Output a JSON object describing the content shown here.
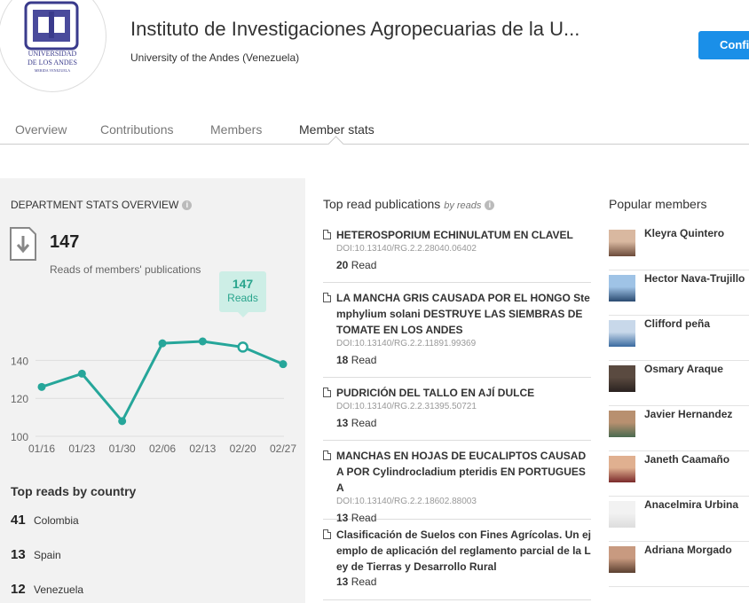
{
  "header": {
    "institution_title": "Instituto de Investigaciones Agropecuarias de la U...",
    "subtitle": "University of the Andes (Venezuela)",
    "confirm_label": "Confi",
    "logo_text": [
      "UNIVERSIDAD",
      "DE LOS ANDES",
      "MERIDA VENEZUELA"
    ]
  },
  "tabs": [
    {
      "label": "Overview"
    },
    {
      "label": "Contributions"
    },
    {
      "label": "Members"
    },
    {
      "label": "Member stats"
    }
  ],
  "stats": {
    "heading": "DEPARTMENT STATS OVERVIEW",
    "total_reads": "147",
    "total_label": "Reads of members' publications",
    "tooltip_value": "147",
    "tooltip_label": "Reads"
  },
  "chart_data": {
    "type": "line",
    "categories": [
      "01/16",
      "01/23",
      "01/30",
      "02/06",
      "02/13",
      "02/20",
      "02/27"
    ],
    "values": [
      126,
      133,
      108,
      149,
      150,
      147,
      138
    ],
    "ylim": [
      100,
      150
    ],
    "yticks": [
      "140",
      "120",
      "100"
    ],
    "highlight_index": 5,
    "color": "#26a69a",
    "grid": true
  },
  "countries": {
    "heading": "Top reads by country",
    "items": [
      {
        "count": "41",
        "name": "Colombia"
      },
      {
        "count": "13",
        "name": "Spain"
      },
      {
        "count": "12",
        "name": "Venezuela"
      }
    ]
  },
  "publications": {
    "heading": "Top read publications",
    "by": "by reads",
    "items": [
      {
        "title": "HETEROSPORIUM ECHINULATUM EN CLAVEL",
        "doi": "DOI:10.13140/RG.2.2.28040.06402",
        "reads": "20",
        "reads_unit": "Read"
      },
      {
        "title": "LA MANCHA GRIS CAUSADA POR EL HONGO Stemphylium solani DESTRUYE LAS SIEMBRAS DE TOMATE EN LOS ANDES",
        "doi": "DOI:10.13140/RG.2.2.11891.99369",
        "reads": "18",
        "reads_unit": "Read"
      },
      {
        "title": "PUDRICIÓN DEL TALLO EN AJÍ DULCE",
        "doi": "DOI:10.13140/RG.2.2.31395.50721",
        "reads": "13",
        "reads_unit": "Read"
      },
      {
        "title": "MANCHAS EN HOJAS DE EUCALIPTOS CAUSADA POR Cylindrocladium pteridis EN PORTUGUESA",
        "doi": "DOI:10.13140/RG.2.2.18602.88003",
        "reads": "13",
        "reads_unit": "Read"
      },
      {
        "title": "Clasificación de Suelos con Fines Agrícolas. Un ejemplo de aplicación del reglamento parcial de la Ley de Tierras y Desarrollo Rural",
        "doi": "",
        "reads": "13",
        "reads_unit": "Read"
      }
    ]
  },
  "members": {
    "heading": "Popular members",
    "items": [
      {
        "name": "Kleyra Quintero"
      },
      {
        "name": "Hector Nava-Trujillo"
      },
      {
        "name": "Clifford peña"
      },
      {
        "name": "Osmary Araque"
      },
      {
        "name": "Javier Hernandez"
      },
      {
        "name": "Janeth Caamaño"
      },
      {
        "name": "Anacelmira Urbina"
      },
      {
        "name": "Adriana Morgado"
      }
    ]
  }
}
